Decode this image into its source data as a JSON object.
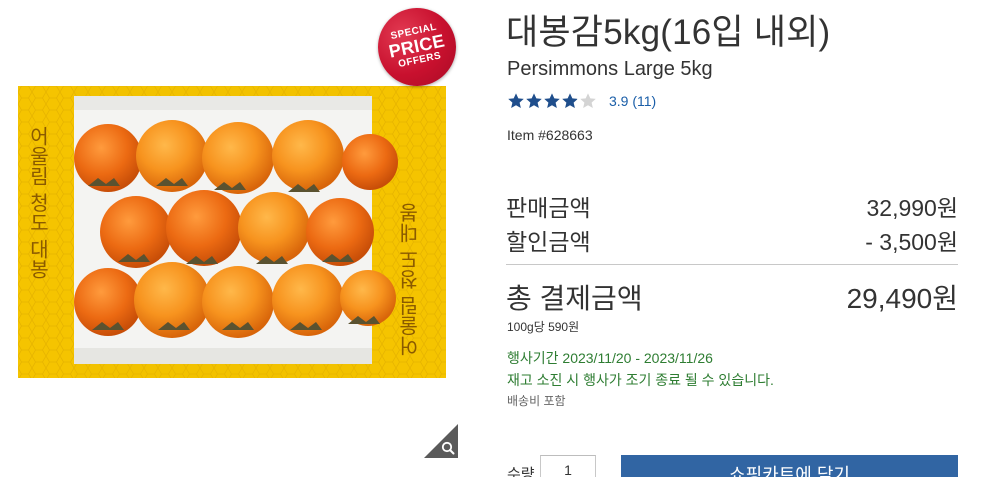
{
  "image": {
    "badge": {
      "line1": "SPECIAL",
      "line2": "PRICE",
      "line3": "OFFERS"
    },
    "box_text_left": "어울림 청도 대봉",
    "box_text_right": "어울림 청도 대봉",
    "zoom_icon": "magnifier-icon"
  },
  "product": {
    "title_ko": "대봉감5kg(16입 내외)",
    "title_en": "Persimmons Large 5kg",
    "rating": {
      "stars": 3.9,
      "max": 5,
      "text": "3.9 (11)"
    },
    "item_number": "Item #628663"
  },
  "pricing": {
    "sale_label": "판매금액",
    "sale_value": "32,990원",
    "discount_label": "할인금액",
    "discount_value": "- 3,500원",
    "total_label": "총 결제금액",
    "total_value": "29,490원",
    "unit_price": "100g당 590원"
  },
  "promotion": {
    "period": "행사기간 2023/11/20 - 2023/11/26",
    "notice": "재고 소진 시 행사가 조기 종료 될 수 있습니다.",
    "shipping": "배송비 포함"
  },
  "purchase": {
    "qty_label": "수량",
    "qty_value": "1",
    "cart_button": "쇼핑카트에 담기"
  },
  "colors": {
    "accent_blue": "#3165a3",
    "link_blue": "#1a5ea8",
    "promo_green": "#2e7d32",
    "badge_red": "#c8102e",
    "box_yellow": "#f2c200"
  }
}
